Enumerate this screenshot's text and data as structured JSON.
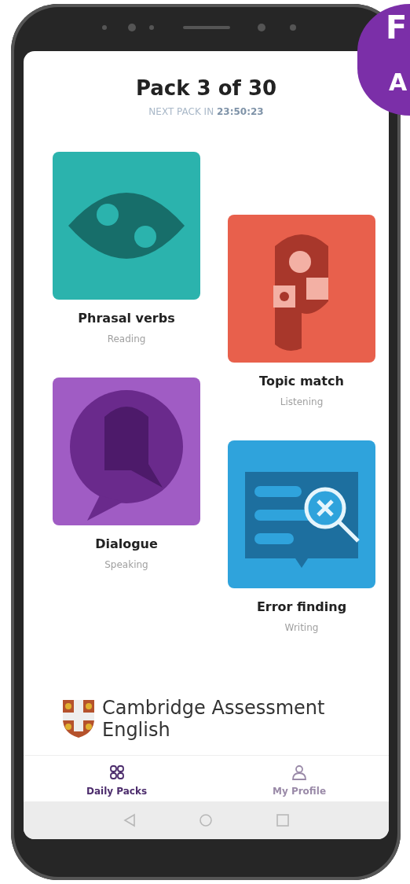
{
  "header": {
    "title": "Pack 3 of 30",
    "countdown_label": "NEXT PACK IN",
    "countdown_time": "23:50:23"
  },
  "activities": [
    {
      "title": "Phrasal verbs",
      "skill": "Reading",
      "color": "#2bb3ad",
      "kind": "eye"
    },
    {
      "title": "Topic match",
      "skill": "Listening",
      "color": "#e8604c",
      "kind": "puzzle"
    },
    {
      "title": "Dialogue",
      "skill": "Speaking",
      "color": "#a05cc4",
      "kind": "chat"
    },
    {
      "title": "Error finding",
      "skill": "Writing",
      "color": "#2fa3dc",
      "kind": "book"
    }
  ],
  "logo": {
    "line1": "Cambridge Assessment",
    "line2": "English"
  },
  "tabs": [
    {
      "label": "Daily Packs",
      "selected": true,
      "kind": "packs"
    },
    {
      "label": "My Profile",
      "selected": false,
      "kind": "profile"
    }
  ],
  "corner_badge": {
    "letters": [
      "F",
      "A"
    ]
  }
}
